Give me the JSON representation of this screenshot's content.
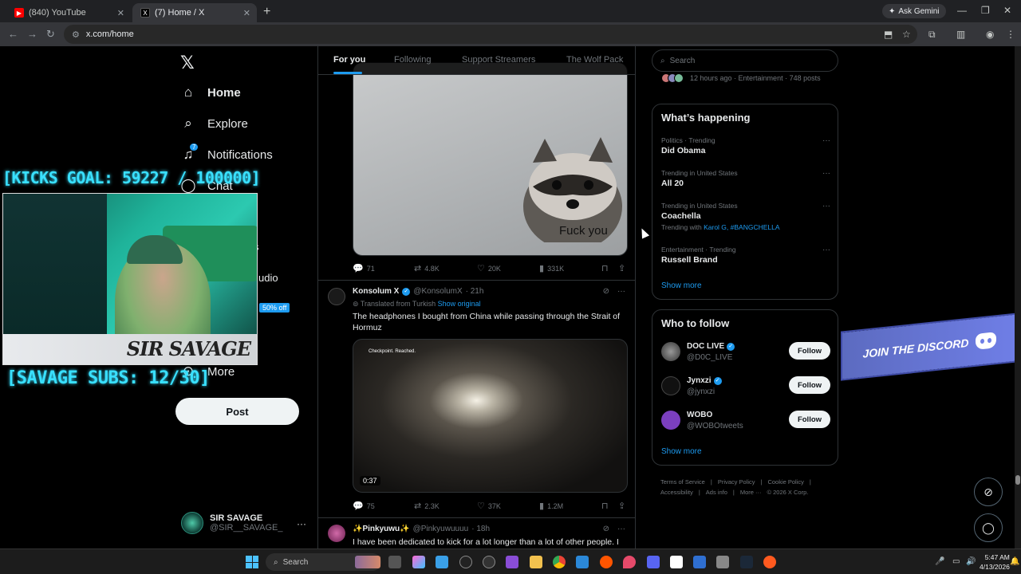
{
  "browser": {
    "tabs": [
      {
        "label": "(840) YouTube",
        "active": false
      },
      {
        "label": "(7) Home / X",
        "active": true
      }
    ],
    "ask_gemini": "Ask Gemini",
    "url": "x.com/home"
  },
  "nav": {
    "home": "Home",
    "explore": "Explore",
    "notifications": "Notifications",
    "notifications_count": "7",
    "chat": "Chat",
    "partial_s": "s",
    "partial_studio": "udio",
    "more": "More",
    "post": "Post",
    "discount": "50% off"
  },
  "profile": {
    "name": "SIR SAVAGE",
    "handle": "@SIR__SAVAGE_"
  },
  "overlay": {
    "kicks_goal": "[KICKS GOAL: 59227 / 100000]",
    "savage_subs": "[SAVAGE SUBS: 12/30]",
    "cam_logo": "SIR SAVAGE"
  },
  "timeline": {
    "tabs": [
      "For you",
      "Following",
      "Support Streamers",
      "The Wolf Pack"
    ],
    "post1": {
      "image_caption": "Fuck you",
      "replies": "71",
      "reposts": "4.8K",
      "likes": "20K",
      "views": "331K"
    },
    "post2": {
      "name": "Konsolum X",
      "handle": "@KonsolumX",
      "time": "· 21h",
      "translated": "Translated from Turkish",
      "show_original": "Show original",
      "text": "The headphones I bought from China while passing through the Strait of Hormuz",
      "video_overlay": "Checkpoint. Reached.",
      "duration": "0:37",
      "replies": "75",
      "reposts": "2.3K",
      "likes": "37K",
      "views": "1.2M"
    },
    "post3": {
      "name": "✨Pinkyuwu✨",
      "handle": "@Pinkyuwuuuu",
      "time": "· 18h",
      "text": "I have been dedicated to kick for a lot longer than a lot of other people. I"
    }
  },
  "sidebar": {
    "search_placeholder": "Search",
    "trend_top_meta": "12 hours ago · Entertainment · 748 posts",
    "whats_happening": "What’s happening",
    "trends": [
      {
        "meta": "Politics · Trending",
        "topic": "Did Obama",
        "with": ""
      },
      {
        "meta": "Trending in United States",
        "topic": "All 20",
        "with": ""
      },
      {
        "meta": "Trending in United States",
        "topic": "Coachella",
        "with_prefix": "Trending with",
        "with": "Karol G, #BANGCHELLA"
      },
      {
        "meta": "Entertainment · Trending",
        "topic": "Russell Brand",
        "with": ""
      }
    ],
    "show_more": "Show more",
    "who_to_follow": "Who to follow",
    "follow_suggestions": [
      {
        "name": "DOC LIVE",
        "handle": "@D0C_LIVE",
        "button": "Follow"
      },
      {
        "name": "Jynxzi",
        "handle": "@jynxzi",
        "button": "Follow"
      },
      {
        "name": "WOBO",
        "handle": "@WOBOtweets",
        "button": "Follow"
      }
    ],
    "show_more_2": "Show more",
    "footer": [
      "Terms of Service",
      "|",
      "Privacy Policy",
      "|",
      "Cookie Policy",
      "|",
      "Accessibility",
      "|",
      "Ads info",
      "|",
      "More ···",
      "© 2026 X Corp."
    ]
  },
  "discord_banner": "JOIN THE DISCORD",
  "taskbar": {
    "search": "Search",
    "time": "5:47 AM",
    "date": "4/13/2026"
  },
  "colors": {
    "accent": "#1d9bf0",
    "overlay_cyan": "#39e0ff",
    "discord": "#6f7ee6"
  }
}
